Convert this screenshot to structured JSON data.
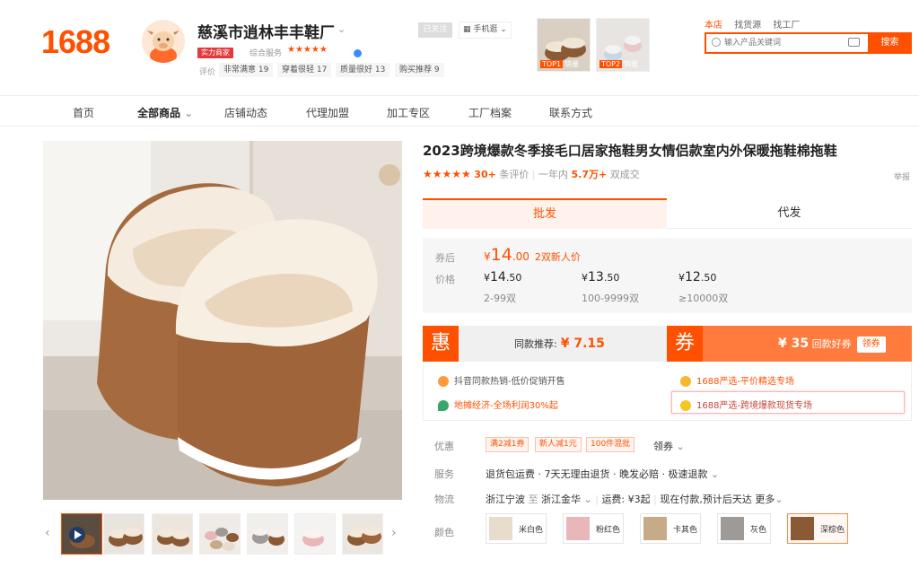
{
  "header": {
    "logo": "1688",
    "shop_name": "慈溪市逍林丰丰鞋厂",
    "strength_tag": "实力商家",
    "rating_label": "综合服务",
    "rating_stars": "★★★★★",
    "eval_label": "评价",
    "eval_chips": [
      "非常满意 19",
      "穿着很轻 17",
      "质量很好 13",
      "购买推荐 9"
    ],
    "follow": "已关注",
    "mobile": "手机逛",
    "top_products": [
      {
        "badge": "TOP1",
        "text": "销量"
      },
      {
        "badge": "TOP2",
        "text": "销量"
      }
    ],
    "search_tabs": [
      "本店",
      "找货源",
      "找工厂"
    ],
    "search_placeholder": "输入产品关键词",
    "search_button": "搜索"
  },
  "nav": [
    "首页",
    "全部商品",
    "店铺动态",
    "代理加盟",
    "加工专区",
    "工厂档案",
    "联系方式"
  ],
  "product": {
    "title": "2023跨境爆款冬季接毛口居家拖鞋男女情侣款室内外保暖拖鞋棉拖鞋",
    "stars": "★★★★★",
    "review_count": "30+",
    "review_label": "条评价",
    "sales_prefix": "一年内",
    "sales_count": "5.7万+",
    "sales_suffix": "双成交",
    "report": "举报",
    "tabs": [
      "批发",
      "代发"
    ]
  },
  "prices": {
    "coupon_label": "券后",
    "price_label": "价格",
    "coupon_sym": "¥",
    "coupon_int": "14",
    "coupon_dec": ".00",
    "coupon_note": "2双新人价",
    "tiers": [
      {
        "sym": "¥",
        "int": "14",
        "dec": ".50",
        "range": "2-99双"
      },
      {
        "sym": "¥",
        "int": "13",
        "dec": ".50",
        "range": "100-9999双"
      },
      {
        "sym": "¥",
        "int": "12",
        "dec": ".50",
        "range": "≥10000双"
      }
    ]
  },
  "promo": {
    "hui": "惠",
    "hui_text": "同款推荐:",
    "hui_price": "¥ 7.15",
    "quan": "券",
    "quan_price": "¥ 35",
    "quan_text": "回款好券",
    "quan_btn": "领券"
  },
  "activities": [
    "抖音同款热销-低价促销开售",
    "1688严选-平价精选专场",
    "地摊经济-全场利润30%起",
    "1688严选-跨境爆款现货专场"
  ],
  "info": {
    "discount_label": "优惠",
    "discount_chips": [
      "满2减1券",
      "新人减1元",
      "100件混批"
    ],
    "discount_more": "领券",
    "service_label": "服务",
    "service_text": "退货包运费 · 7天无理由退货 · 晚发必赔 · 极速退款",
    "logistics_label": "物流",
    "logistics_from": "浙江宁波",
    "logistics_to_word": "至",
    "logistics_to": "浙江金华",
    "logistics_fee": "运费: ¥3起",
    "logistics_ship": "现在付款,预计后天达",
    "logistics_more": "更多",
    "color_label": "颜色",
    "colors": [
      {
        "name": "米白色",
        "hex": "#e8dccb"
      },
      {
        "name": "粉红色",
        "hex": "#e7b7b9"
      },
      {
        "name": "卡其色",
        "hex": "#c7aa88"
      },
      {
        "name": "灰色",
        "hex": "#9d9a97"
      },
      {
        "name": "深棕色",
        "hex": "#8a5a35"
      }
    ]
  },
  "colors": {
    "accent": "#ff5000",
    "accent_light": "#ff7a3d"
  }
}
